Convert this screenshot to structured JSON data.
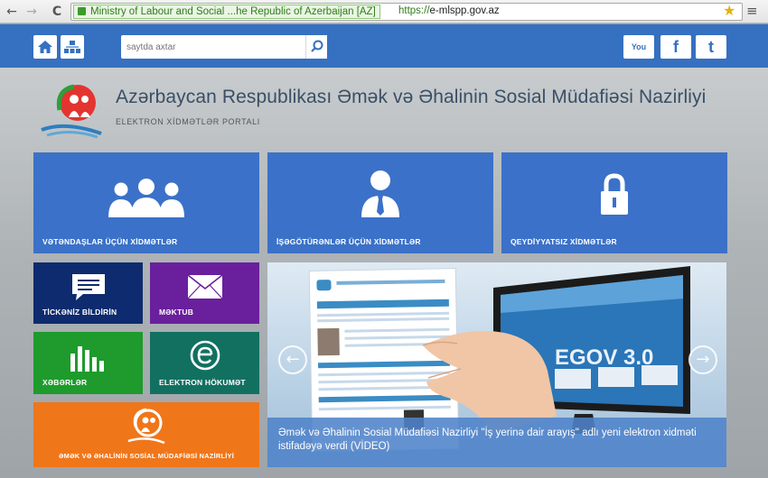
{
  "browser": {
    "back_icon": "←",
    "forward_icon": "→",
    "reload_icon": "C",
    "ev_label": "Ministry of Labour and Social ...he Republic of Azerbaijan [AZ]",
    "url_scheme": "https://",
    "url_host": "e-mlspp.gov.az",
    "bookmark_icon": "★",
    "menu_icon": "≡"
  },
  "header": {
    "search_placeholder": "saytda axtar",
    "social": {
      "youtube": "You",
      "facebook": "f",
      "twitter": "t"
    }
  },
  "site": {
    "title": "Azərbaycan Respublikası Əmək və Əhalinin Sosial Müdafiəsi Nazirliyi",
    "subtitle": "ELEKTRON XİDMƏTLƏR PORTALI"
  },
  "tiles": {
    "citizens": "VƏTƏNDAŞLAR ÜÇÜN XİDMƏTLƏR",
    "employers": "İŞƏGÖTÜRƏNLƏR ÜÇÜN XİDMƏTLƏR",
    "no_registration": "QEYDİYYATSIZ XİDMƏTLƏR",
    "complaint": "TİCKƏNİZ BİLDİRİN",
    "letter": "MƏKTUB",
    "reports": "XƏBƏRLƏR",
    "e_receipt": "ELEKTRON HÖKUMƏT",
    "ministry": "ƏMƏK VƏ ƏHALİNİN SOSİAL MÜDAFİƏSİ NAZİRLİYİ"
  },
  "slider": {
    "screen_text": "EGOV 3.0",
    "caption": "Əmək və Əhalinin Sosial Müdafiəsi Nazirliyi \"İş yerinə dair arayış\" adlı yeni elektron xidməti istifadəyə verdi (VİDEO)",
    "prev_icon": "←",
    "next_icon": "→"
  },
  "colors": {
    "header_blue": "#3570c1",
    "tile_blue": "#3b71c8",
    "navy": "#0d2b6e",
    "purple": "#6a1f9c",
    "green": "#1e9b2c",
    "teal": "#127061",
    "orange": "#f0761a"
  }
}
